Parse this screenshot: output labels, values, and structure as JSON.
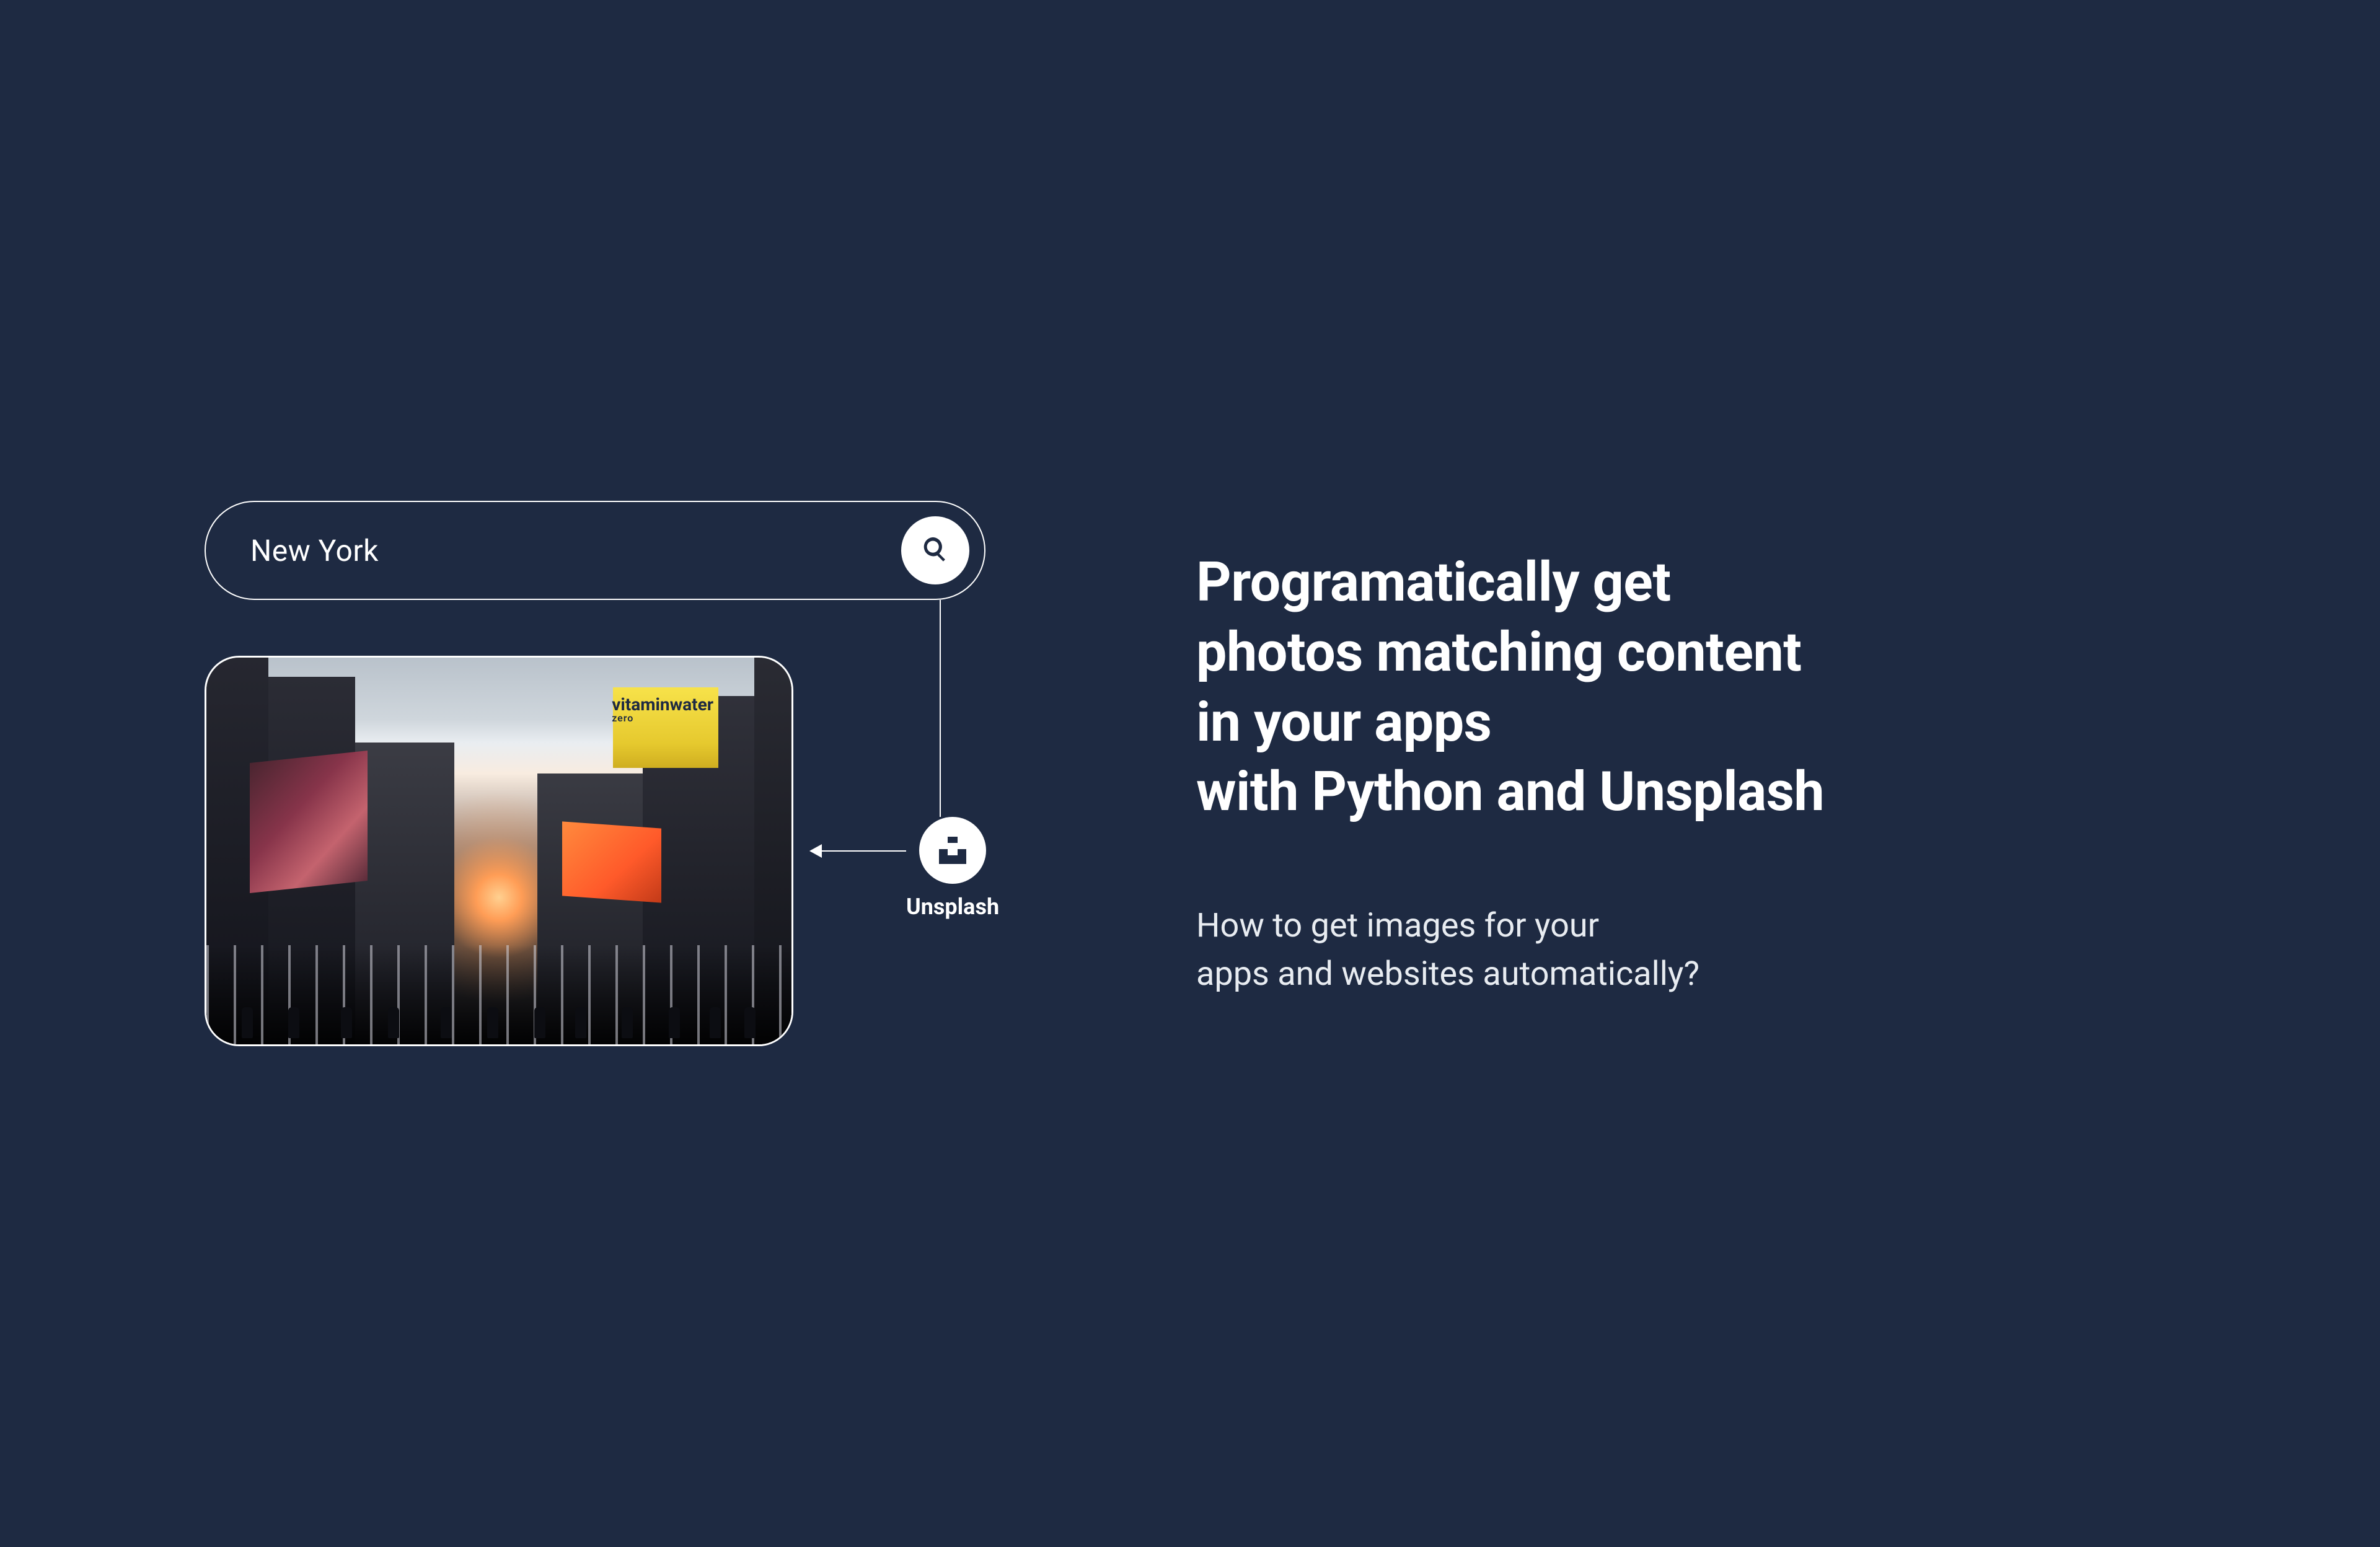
{
  "search": {
    "query": "New York"
  },
  "provider": {
    "label": "Unsplash"
  },
  "billboard": {
    "line1": "vitaminwater",
    "line2": "zero"
  },
  "heading": "Programatically get\nphotos matching content\nin your apps\nwith Python and Unsplash",
  "subheading": "How to get images for your\napps and websites automatically?",
  "colors": {
    "background": "#1e2a42",
    "foreground": "#ffffff"
  }
}
